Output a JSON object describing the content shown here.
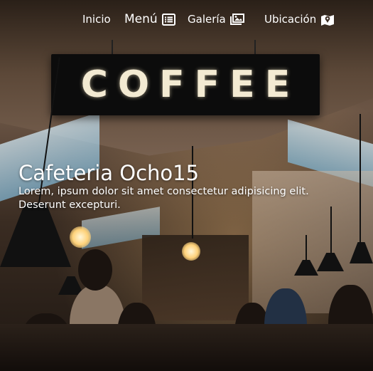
{
  "nav": {
    "items": [
      {
        "label": "Inicio",
        "icon": ""
      },
      {
        "label": "Menú",
        "icon": "menu-list-icon"
      },
      {
        "label": "Galería",
        "icon": "gallery-icon"
      },
      {
        "label": "Ubicación",
        "icon": "map-icon"
      }
    ]
  },
  "hero": {
    "sign_text": "COFFEE",
    "title": "Cafeteria Ocho15",
    "description": "Lorem, ipsum dolor sit amet consectetur adipisicing elit. Deserunt excepturi."
  },
  "colors": {
    "text": "#ffffff",
    "sign_background": "#0c0c0c",
    "sign_letters": "#f3ead2"
  }
}
